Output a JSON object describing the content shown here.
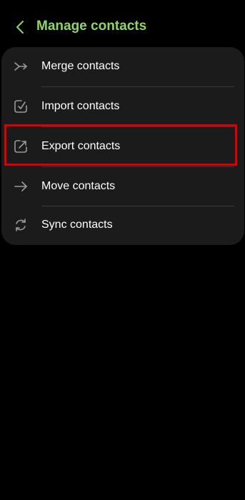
{
  "colors": {
    "background": "#000000",
    "card": "#1b1b1b",
    "accent": "#8fd567",
    "text": "#ffffff",
    "icon": "#9a9a9a",
    "highlight": "#dd0000"
  },
  "header": {
    "back_icon": "chevron-left-icon",
    "title": "Manage contacts"
  },
  "menu": {
    "items": [
      {
        "label": "Merge contacts",
        "icon": "merge-icon"
      },
      {
        "label": "Import contacts",
        "icon": "import-icon"
      },
      {
        "label": "Export contacts",
        "icon": "export-icon",
        "highlighted": true
      },
      {
        "label": "Move contacts",
        "icon": "arrow-right-icon"
      },
      {
        "label": "Sync contacts",
        "icon": "sync-icon"
      }
    ]
  }
}
